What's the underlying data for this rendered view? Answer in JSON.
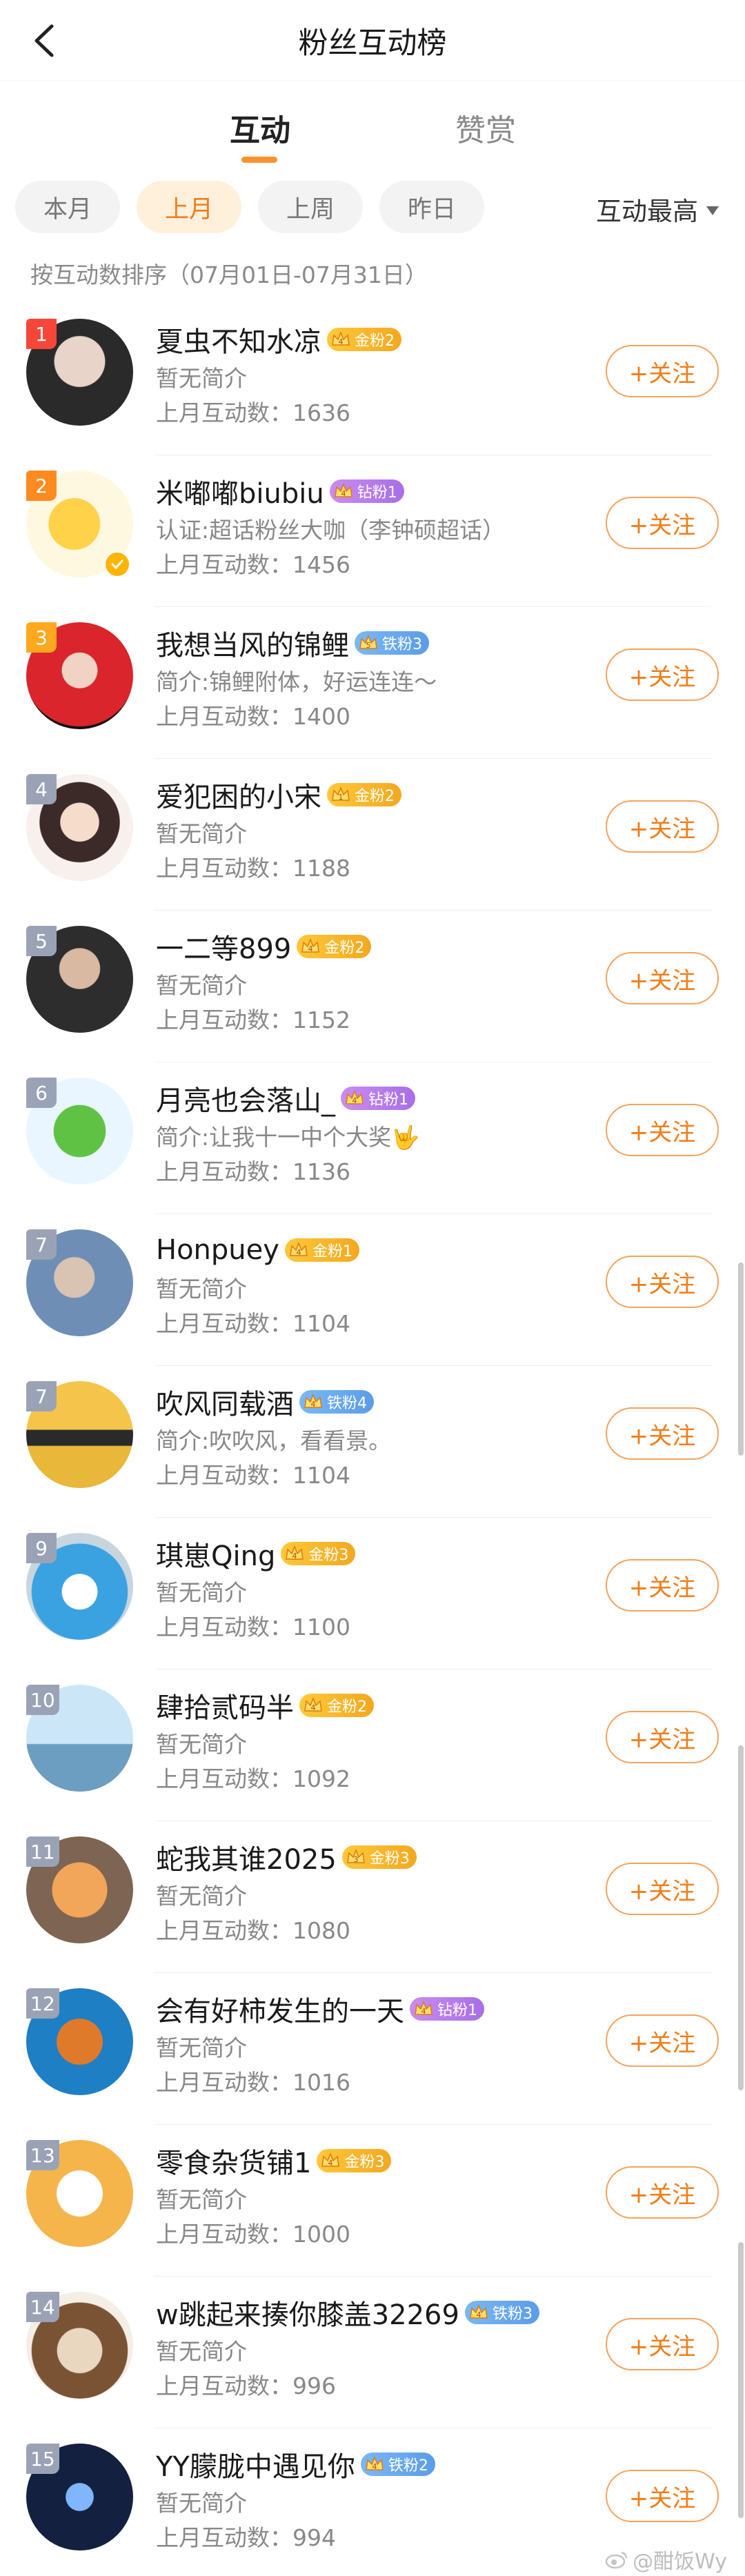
{
  "header": {
    "title": "粉丝互动榜",
    "back_icon": "chevron-left-icon"
  },
  "tabs": [
    {
      "label": "互动",
      "active": true
    },
    {
      "label": "赞赏",
      "active": false
    }
  ],
  "filters": {
    "chips": [
      {
        "label": "本月",
        "active": false
      },
      {
        "label": "上月",
        "active": true
      },
      {
        "label": "上周",
        "active": false
      },
      {
        "label": "昨日",
        "active": false
      }
    ],
    "sort_label": "互动最高"
  },
  "subtitle": "按互动数排序（07月01日-07月31日）",
  "follow_label": "+关注",
  "accent_color": "#f07d18",
  "users": [
    {
      "rank": "1",
      "name": "夏虫不知水凉",
      "badge_level": "4",
      "badge": "金粉2",
      "badge_type": "gold",
      "intro": "暂无简介",
      "count": "上月互动数：1636"
    },
    {
      "rank": "2",
      "name": "米嘟嘟biubiu",
      "badge_level": "4",
      "badge": "钻粉1",
      "badge_type": "diamond",
      "intro": "认证:超话粉丝大咖（李钟硕超话）",
      "count": "上月互动数：1456",
      "verified": true
    },
    {
      "rank": "3",
      "name": "我想当风的锦鲤",
      "badge_level": "5",
      "badge": "铁粉3",
      "badge_type": "iron",
      "intro": "简介:锦鲤附体，好运连连～",
      "count": "上月互动数：1400"
    },
    {
      "rank": "4",
      "name": "爱犯困的小宋",
      "badge_level": "1",
      "badge": "金粉2",
      "badge_type": "gold",
      "intro": "暂无简介",
      "count": "上月互动数：1188"
    },
    {
      "rank": "5",
      "name": "一二等899",
      "badge_level": "4",
      "badge": "金粉2",
      "badge_type": "gold",
      "intro": "暂无简介",
      "count": "上月互动数：1152"
    },
    {
      "rank": "6",
      "name": "月亮也会落山_",
      "badge_level": "4",
      "badge": "钻粉1",
      "badge_type": "diamond",
      "intro": "简介:让我十一中个大奖🤟",
      "count": "上月互动数：1136"
    },
    {
      "rank": "7",
      "name": "Honpuey",
      "badge_level": "4",
      "badge": "金粉1",
      "badge_type": "gold",
      "intro": "暂无简介",
      "count": "上月互动数：1104"
    },
    {
      "rank": "7",
      "name": "吹风同载酒",
      "badge_level": "4",
      "badge": "铁粉4",
      "badge_type": "iron",
      "intro": "简介:吹吹风，看看景。",
      "count": "上月互动数：1104"
    },
    {
      "rank": "9",
      "name": "琪崽Qing",
      "badge_level": "4",
      "badge": "金粉3",
      "badge_type": "gold",
      "intro": "暂无简介",
      "count": "上月互动数：1100"
    },
    {
      "rank": "10",
      "name": "肆拾贰码半",
      "badge_level": "4",
      "badge": "金粉2",
      "badge_type": "gold",
      "intro": "暂无简介",
      "count": "上月互动数：1092"
    },
    {
      "rank": "11",
      "name": "蛇我其谁2025",
      "badge_level": "3",
      "badge": "金粉3",
      "badge_type": "gold",
      "intro": "暂无简介",
      "count": "上月互动数：1080"
    },
    {
      "rank": "12",
      "name": "会有好柿发生的一天",
      "badge_level": "4",
      "badge": "钻粉1",
      "badge_type": "diamond",
      "intro": "暂无简介",
      "count": "上月互动数：1016"
    },
    {
      "rank": "13",
      "name": "零食杂货铺1",
      "badge_level": "4",
      "badge": "金粉3",
      "badge_type": "gold",
      "intro": "暂无简介",
      "count": "上月互动数：1000"
    },
    {
      "rank": "14",
      "name": "w跳起来揍你膝盖32269",
      "badge_level": "4",
      "badge": "铁粉3",
      "badge_type": "iron",
      "intro": "暂无简介",
      "count": "上月互动数：996"
    },
    {
      "rank": "15",
      "name": "YY朦胧中遇见你",
      "badge_level": "4",
      "badge": "铁粉2",
      "badge_type": "iron",
      "intro": "暂无简介",
      "count": "上月互动数：994"
    }
  ],
  "watermark": "@酣饭Wy"
}
